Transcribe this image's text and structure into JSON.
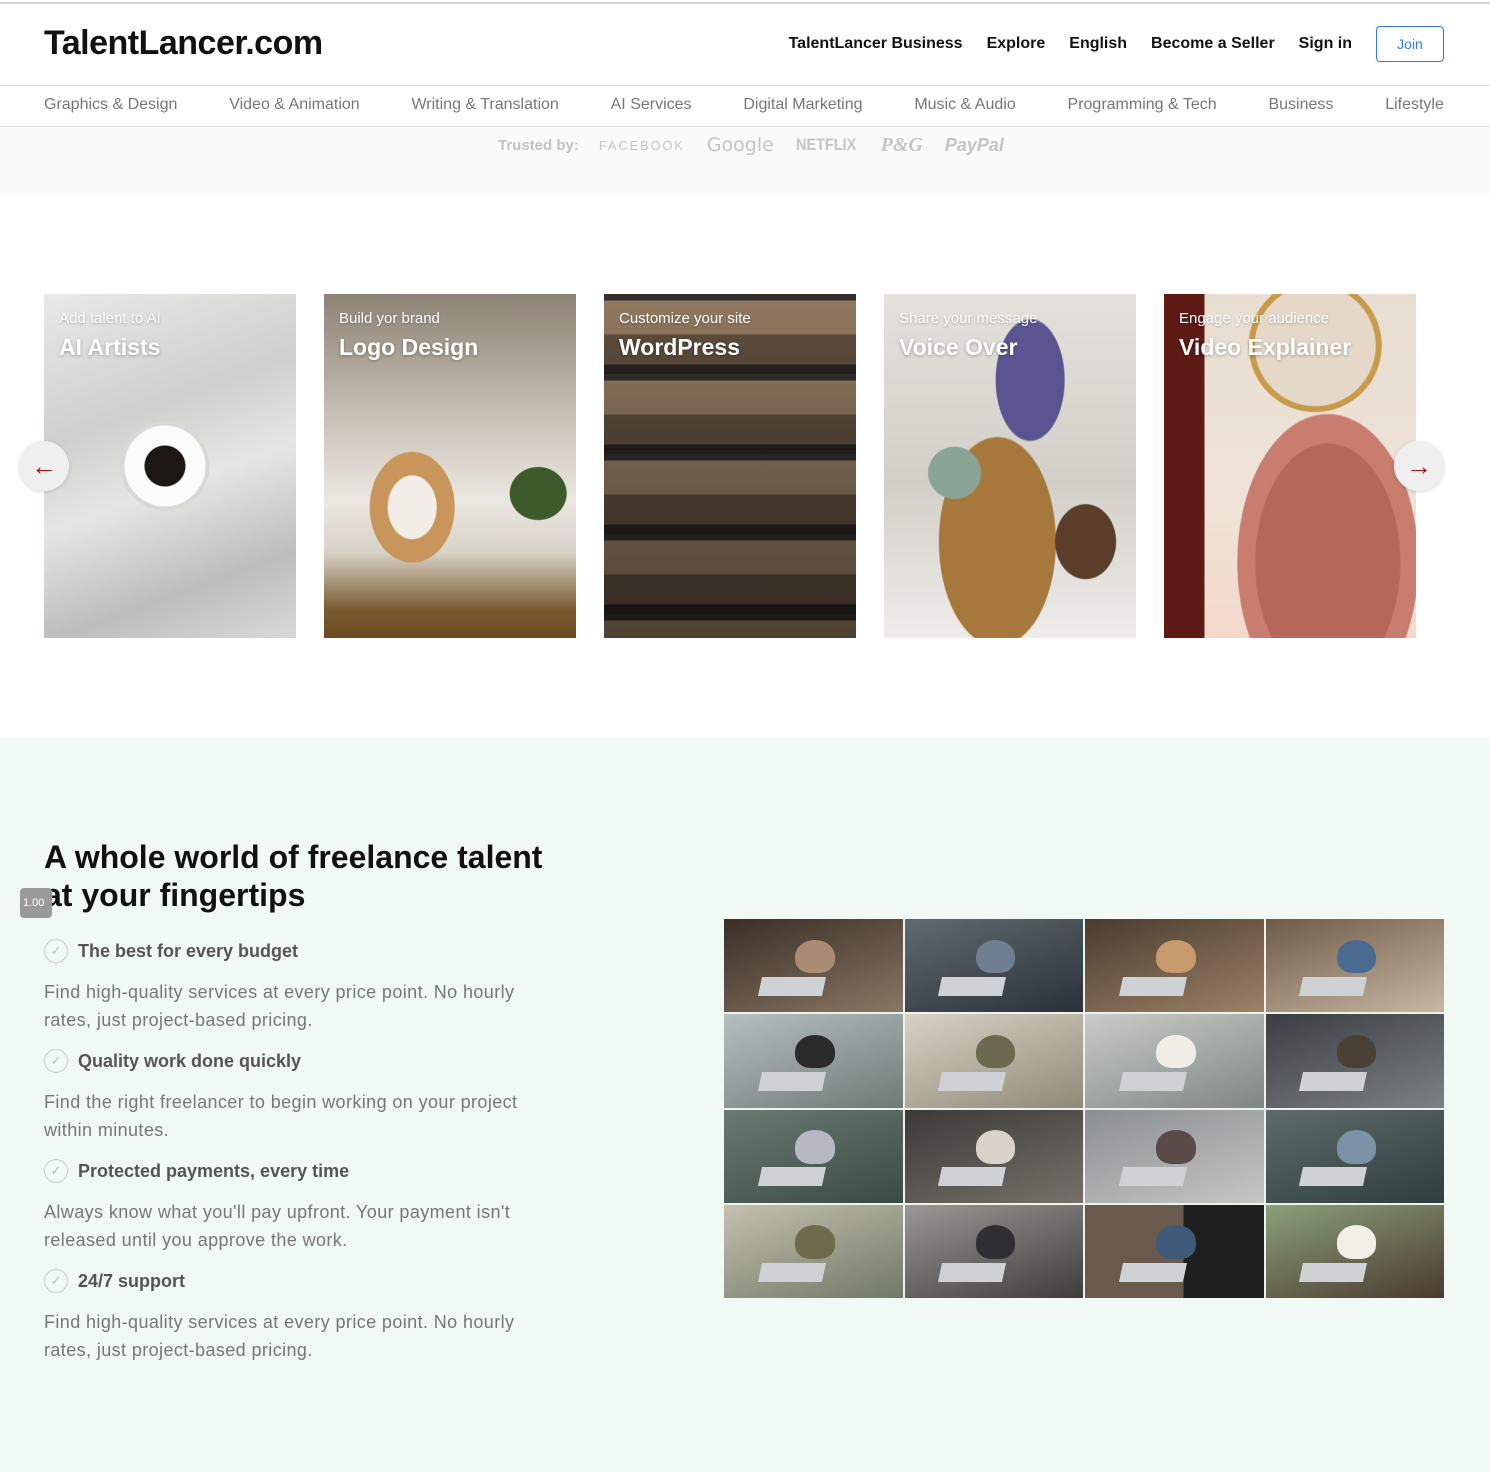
{
  "header": {
    "logo": "TalentLancer.com",
    "nav": [
      "TalentLancer Business",
      "Explore",
      "English",
      "Become a Seller",
      "Sign in"
    ],
    "join_label": "Join"
  },
  "categories": [
    "Graphics & Design",
    "Video & Animation",
    "Writing & Translation",
    "AI Services",
    "Digital Marketing",
    "Music & Audio",
    "Programming & Tech",
    "Business",
    "Lifestyle"
  ],
  "trusted": {
    "label": "Trusted by:",
    "brands": [
      "FACEBOOK",
      "Google",
      "NETFLIX",
      "P&G",
      "PayPal"
    ]
  },
  "carousel": {
    "cards": [
      {
        "subtitle": "Add talent to AI",
        "title": "AI Artists"
      },
      {
        "subtitle": "Build yor brand",
        "title": "Logo Design"
      },
      {
        "subtitle": "Customize your site",
        "title": "WordPress"
      },
      {
        "subtitle": "Share your message",
        "title": "Voice Over"
      },
      {
        "subtitle": "Engage your audience",
        "title": "Video Explainer"
      }
    ],
    "prev_icon": "←",
    "next_icon": "→"
  },
  "features": {
    "title": "A whole world of freelance talent at your fingertips",
    "zoom_badge": "1.00",
    "items": [
      {
        "heading": "The best for every budget",
        "text": "Find high-quality services at every price point. No hourly rates, just project-based pricing."
      },
      {
        "heading": "Quality work done quickly",
        "text": "Find the right freelancer to begin working on your project within minutes."
      },
      {
        "heading": "Protected payments, every time",
        "text": "Always know what you'll pay upfront. Your payment isn't released until you approve the work."
      },
      {
        "heading": "24/7 support",
        "text": "Find high-quality services at every price point. No hourly rates, just project-based pricing."
      }
    ],
    "check_icon": "✓"
  },
  "colors": {
    "accent": "#2f7fd8",
    "arrow": "#a01515",
    "features_bg": "#f1f9f4"
  }
}
